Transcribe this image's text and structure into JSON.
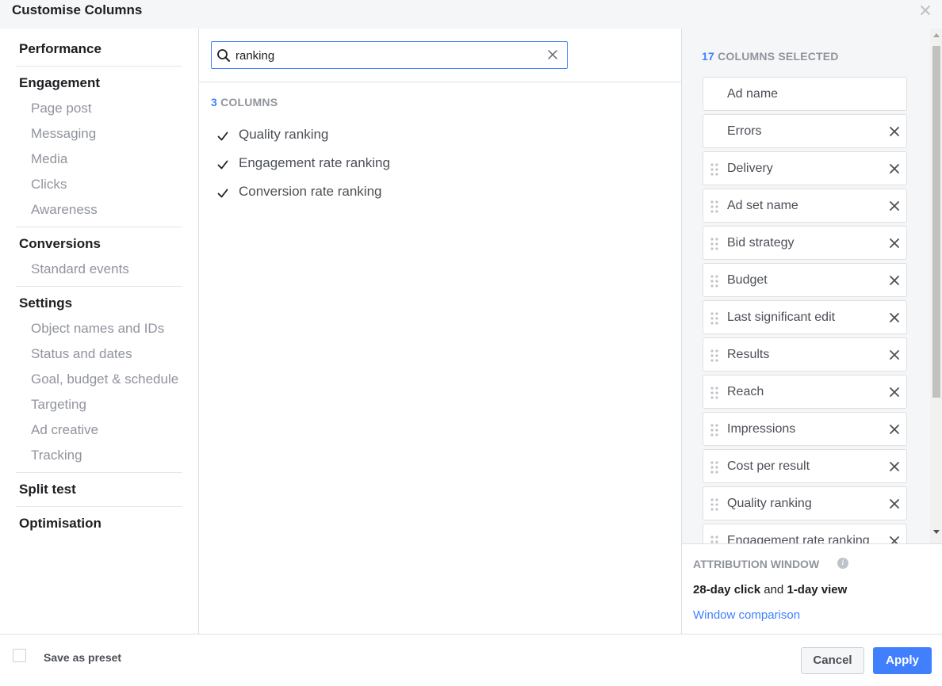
{
  "dialog": {
    "title": "Customise Columns",
    "close_icon": "close-icon"
  },
  "categories": [
    {
      "name": "Performance",
      "subs": []
    },
    {
      "name": "Engagement",
      "subs": [
        "Page post",
        "Messaging",
        "Media",
        "Clicks",
        "Awareness"
      ]
    },
    {
      "name": "Conversions",
      "subs": [
        "Standard events"
      ]
    },
    {
      "name": "Settings",
      "subs": [
        "Object names and IDs",
        "Status and dates",
        "Goal, budget & schedule",
        "Targeting",
        "Ad creative",
        "Tracking"
      ]
    },
    {
      "name": "Split test",
      "subs": []
    },
    {
      "name": "Optimisation",
      "subs": []
    }
  ],
  "search": {
    "value": "ranking",
    "placeholder": "Search"
  },
  "results": {
    "count": "3",
    "count_suffix": "COLUMNS",
    "items": [
      {
        "label": "Quality ranking",
        "checked": true
      },
      {
        "label": "Engagement rate ranking",
        "checked": true
      },
      {
        "label": "Conversion rate ranking",
        "checked": true
      }
    ]
  },
  "selected": {
    "count": "17",
    "count_suffix": "COLUMNS SELECTED",
    "items": [
      {
        "label": "Ad name",
        "removable": false,
        "draggable": false
      },
      {
        "label": "Errors",
        "removable": true,
        "draggable": false
      },
      {
        "label": "Delivery",
        "removable": true,
        "draggable": true
      },
      {
        "label": "Ad set name",
        "removable": true,
        "draggable": true
      },
      {
        "label": "Bid strategy",
        "removable": true,
        "draggable": true
      },
      {
        "label": "Budget",
        "removable": true,
        "draggable": true
      },
      {
        "label": "Last significant edit",
        "removable": true,
        "draggable": true
      },
      {
        "label": "Results",
        "removable": true,
        "draggable": true
      },
      {
        "label": "Reach",
        "removable": true,
        "draggable": true
      },
      {
        "label": "Impressions",
        "removable": true,
        "draggable": true
      },
      {
        "label": "Cost per result",
        "removable": true,
        "draggable": true
      },
      {
        "label": "Quality ranking",
        "removable": true,
        "draggable": true
      },
      {
        "label": "Engagement rate ranking",
        "removable": true,
        "draggable": true
      }
    ]
  },
  "attribution": {
    "title": "ATTRIBUTION WINDOW",
    "click": "28-day click",
    "and": "and",
    "view": "1-day view",
    "link": "Window comparison"
  },
  "footer": {
    "preset_label": "Save as preset",
    "cancel_label": "Cancel",
    "apply_label": "Apply"
  },
  "colors": {
    "accent": "#4080ff",
    "muted": "#90949c",
    "panel_bg": "#f5f6f7"
  }
}
